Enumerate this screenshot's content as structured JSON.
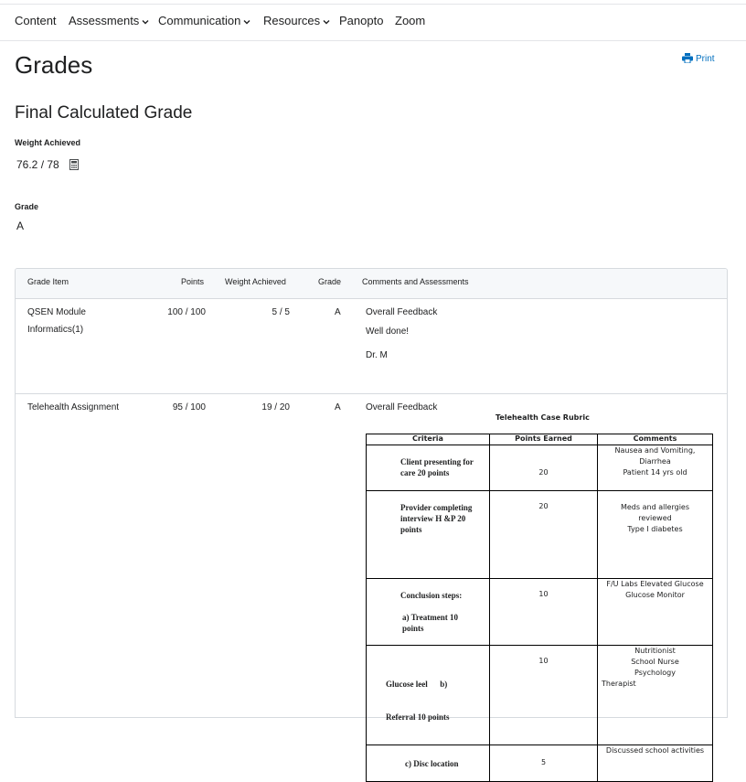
{
  "nav": {
    "items": [
      {
        "label": "Content",
        "dropdown": false
      },
      {
        "label": "Assessments",
        "dropdown": true
      },
      {
        "label": "Communication",
        "dropdown": true
      },
      {
        "label": "Resources",
        "dropdown": true
      },
      {
        "label": "Panopto",
        "dropdown": false
      },
      {
        "label": "Zoom",
        "dropdown": false
      }
    ]
  },
  "page": {
    "title": "Grades",
    "print_label": "Print"
  },
  "final": {
    "heading": "Final Calculated Grade",
    "weight_label": "Weight Achieved",
    "weight_value": "76.2 / 78",
    "grade_label": "Grade",
    "grade_value": "A"
  },
  "table": {
    "headers": {
      "item": "Grade Item",
      "points": "Points",
      "weight": "Weight Achieved",
      "grade": "Grade",
      "comments": "Comments and Assessments"
    },
    "rows": [
      {
        "item_line1": "QSEN Module",
        "item_line2": "Informatics(1)",
        "points": "100 / 100",
        "weight": "5 / 5",
        "grade": "A",
        "feedback_label": "Overall Feedback",
        "feedback_text": "Well done!",
        "feedback_sign": "Dr. M"
      },
      {
        "item_line1": "Telehealth Assignment",
        "points": "95 / 100",
        "weight": "19 / 20",
        "grade": "A",
        "feedback_label": "Overall Feedback"
      }
    ]
  },
  "rubric": {
    "title": "Telehealth Case Rubric",
    "headers": {
      "criteria": "Criteria",
      "points": "Points Earned",
      "comments": "Comments"
    },
    "rows": [
      {
        "criteria": [
          "Client presenting for",
          "care 20 points"
        ],
        "points": "20",
        "comments": [
          "Nausea and Vomiting,",
          "Diarrhea",
          "Patient 14 yrs old"
        ]
      },
      {
        "criteria": [
          "Provider completing",
          "interview H &P 20",
          "points"
        ],
        "points": "20",
        "comments": [
          "Meds and allergies",
          "reviewed",
          "Type I diabetes"
        ]
      },
      {
        "criteria": [
          "Conclusion steps:",
          "",
          "a) Treatment 10",
          "points"
        ],
        "points": "10",
        "comments": [
          "F/U Labs Elevated Glucose",
          "Glucose Monitor"
        ]
      },
      {
        "criteria": [
          "Glucose leel      b)",
          "Referral 10 points"
        ],
        "points": "10",
        "comments": [
          "Nutritionist",
          "School Nurse",
          "Psychology",
          "Therapist"
        ]
      },
      {
        "criteria": [
          "c) Disc location"
        ],
        "points": "5",
        "comments": [
          "Discussed school activities"
        ]
      }
    ]
  },
  "colors": {
    "link": "#006fbf",
    "border": "#d6dade",
    "header_bg": "#f6f8fa"
  }
}
